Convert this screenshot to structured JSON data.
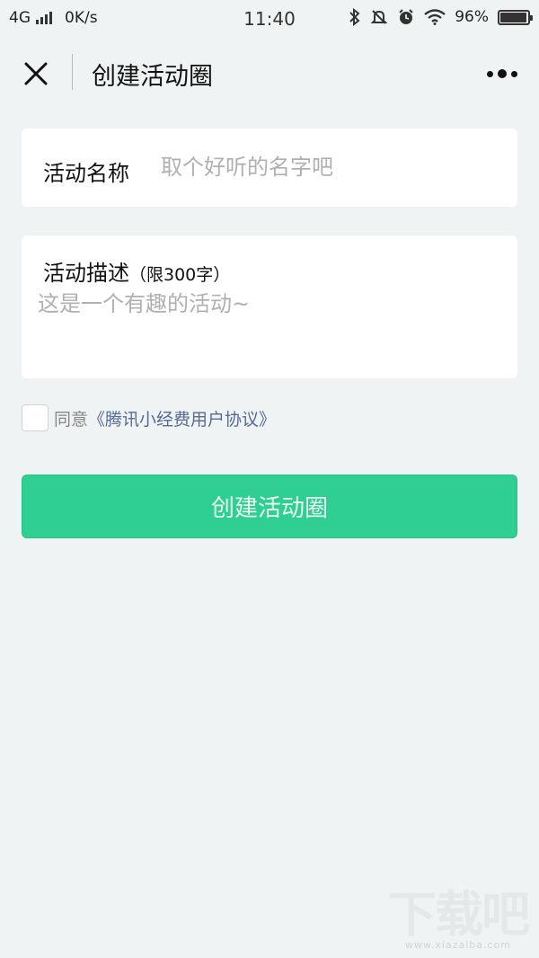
{
  "status_bar": {
    "network": "4G",
    "speed": "0K/s",
    "time": "11:40",
    "battery_percent": "96%",
    "battery_level": 0.96,
    "icons": [
      "signal-icon",
      "bluetooth-icon",
      "mute-bell-icon",
      "alarm-icon",
      "wifi-icon",
      "battery-icon"
    ]
  },
  "nav": {
    "title": "创建活动圈",
    "close_icon": "close-icon",
    "more_icon": "more-icon"
  },
  "form": {
    "name_label": "活动名称",
    "name_placeholder": "取个好听的名字吧",
    "desc_label": "活动描述",
    "desc_limit": "（限300字）",
    "desc_placeholder": "这是一个有趣的活动~",
    "agree_text": "同意",
    "agree_link": "《腾讯小经费用户协议》",
    "submit_label": "创建活动圈"
  },
  "watermark": {
    "logo": "下载吧",
    "url": "www.xiazaiba.com"
  },
  "colors": {
    "background": "#f0f3f3",
    "primary": "#2fcf93",
    "link": "#576b95",
    "placeholder": "#b0b0b0"
  }
}
